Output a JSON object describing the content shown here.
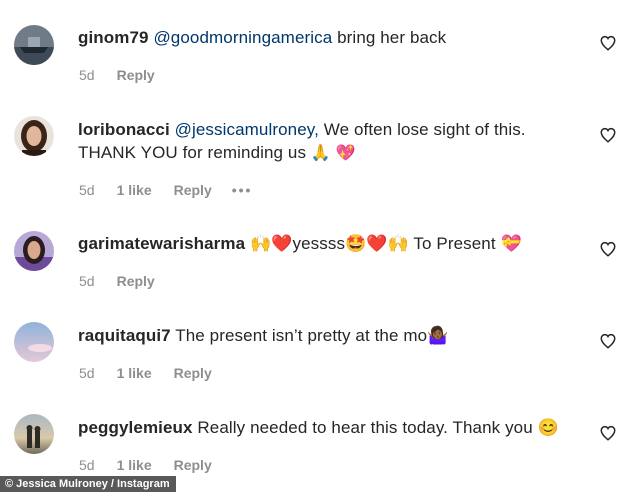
{
  "comments": [
    {
      "username": "ginom79",
      "mention": "@goodmorningamerica",
      "text": " bring her back",
      "time": "5d",
      "likes": "",
      "reply": "Reply",
      "avatar": "boat-avatar"
    },
    {
      "username": "loribonacci",
      "mention": "@jessicamulroney,",
      "text": " We often lose sight of this. THANK YOU for reminding us",
      "emoji": "🙏 💖",
      "time": "5d",
      "likes": "1 like",
      "reply": "Reply",
      "more": "•••",
      "avatar": "woman-portrait-avatar"
    },
    {
      "username": "garimatewarisharma",
      "mention": "",
      "text": " 🙌❤️yessss🤩❤️🙌 To Present 💝",
      "time": "5d",
      "likes": "",
      "reply": "Reply",
      "avatar": "woman-portrait-avatar"
    },
    {
      "username": "raquitaqui7",
      "mention": "",
      "text": " The present isn’t pretty at the mo🤷🏾‍♀️",
      "time": "5d",
      "likes": "1 like",
      "reply": "Reply",
      "avatar": "sky-avatar"
    },
    {
      "username": "peggylemieux",
      "mention": "",
      "text": " Really needed to hear this today. Thank you 😊",
      "time": "5d",
      "likes": "1 like",
      "reply": "Reply",
      "avatar": "sunset-couple-avatar"
    }
  ],
  "credit": "© Jessica Mulroney / Instagram",
  "icons": {
    "like": "heart-outline-icon",
    "more": "more-options-icon"
  }
}
